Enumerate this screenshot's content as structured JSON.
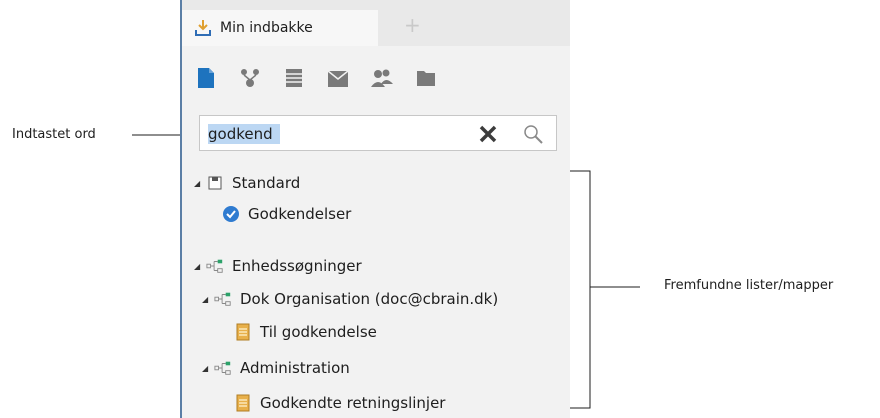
{
  "tabs": {
    "active_label": "Min indbakke",
    "add_label": "+"
  },
  "toolbar": {
    "icons": [
      "new-document-icon",
      "workflow-icon",
      "list-icon",
      "mail-icon",
      "users-icon",
      "folder-icon"
    ]
  },
  "search": {
    "value": "godkend"
  },
  "tree": {
    "standard_group": "Standard",
    "godkendelser": "Godkendelser",
    "unit_searches_group": "Enhedssøgninger",
    "dok_org": "Dok Organisation (doc@cbrain.dk)",
    "til_godkendelse": "Til godkendelse",
    "administration": "Administration",
    "godkendte": "Godkendte retningslinjer"
  },
  "callouts": {
    "typed_word": "Indtastet ord",
    "found_lists": "Fremfundne lister/mapper"
  },
  "colors": {
    "accent_blue": "#1e73be",
    "doc_yellow": "#e8b04a",
    "border_blue": "#5b7fa6"
  }
}
